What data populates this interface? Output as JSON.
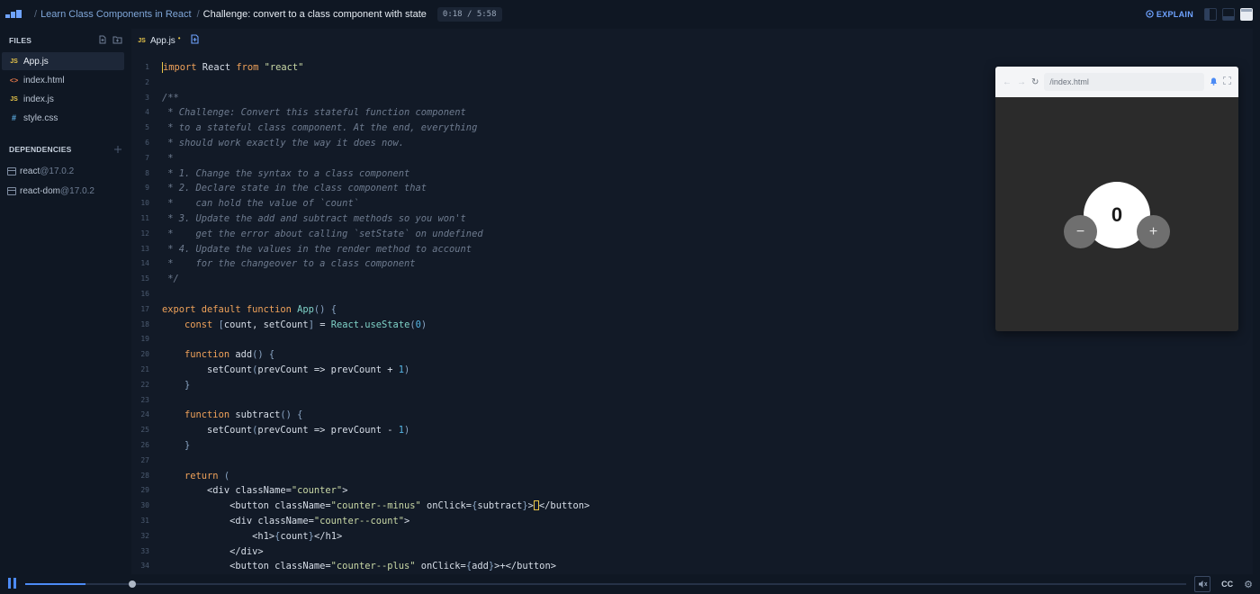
{
  "breadcrumb": {
    "course": "Learn Class Components in React",
    "lesson": "Challenge: convert to a class component with state",
    "timer": "0:18 / 5:58"
  },
  "header": {
    "explain_label": "EXPLAIN"
  },
  "sidebar": {
    "files_title": "FILES",
    "files": [
      {
        "name": "App.js",
        "type": "js",
        "type_label": "JS",
        "active": true
      },
      {
        "name": "index.html",
        "type": "html",
        "type_label": "<>",
        "active": false
      },
      {
        "name": "index.js",
        "type": "js",
        "type_label": "JS",
        "active": false
      },
      {
        "name": "style.css",
        "type": "css",
        "type_label": "#",
        "active": false
      }
    ],
    "deps_title": "DEPENDENCIES",
    "dependencies": [
      {
        "name": "react",
        "version": "@17.0.2"
      },
      {
        "name": "react-dom",
        "version": "@17.0.2"
      }
    ]
  },
  "editor": {
    "tab": {
      "label": "App.js",
      "icon_label": "JS",
      "modified": "•"
    },
    "lines": [
      [
        [
          "kw",
          "import"
        ],
        [
          "txt",
          " React "
        ],
        [
          "kw",
          "from"
        ],
        [
          "txt",
          " "
        ],
        [
          "str",
          "\"react\""
        ]
      ],
      [],
      [
        [
          "cmt",
          "/**"
        ]
      ],
      [
        [
          "cmt",
          " * Challenge: Convert this stateful function component"
        ]
      ],
      [
        [
          "cmt",
          " * to a stateful class component. At the end, everything"
        ]
      ],
      [
        [
          "cmt",
          " * should work exactly the way it does now."
        ]
      ],
      [
        [
          "cmt",
          " *"
        ]
      ],
      [
        [
          "cmt",
          " * 1. Change the syntax to a class component"
        ]
      ],
      [
        [
          "cmt",
          " * 2. Declare state in the class component that"
        ]
      ],
      [
        [
          "cmt",
          " *    can hold the value of `count`"
        ]
      ],
      [
        [
          "cmt",
          " * 3. Update the add and subtract methods so you won't"
        ]
      ],
      [
        [
          "cmt",
          " *    get the error about calling `setState` on undefined"
        ]
      ],
      [
        [
          "cmt",
          " * 4. Update the values in the render method to account"
        ]
      ],
      [
        [
          "cmt",
          " *    for the changeover to a class component"
        ]
      ],
      [
        [
          "cmt",
          " */"
        ]
      ],
      [],
      [
        [
          "kw",
          "export default function "
        ],
        [
          "fn",
          "App"
        ],
        [
          "br",
          "() {"
        ]
      ],
      [
        [
          "txt",
          "    "
        ],
        [
          "kw",
          "const "
        ],
        [
          "br",
          "["
        ],
        [
          "txt",
          "count, setCount"
        ],
        [
          "br",
          "]"
        ],
        [
          "txt",
          " = "
        ],
        [
          "fn",
          "React"
        ],
        [
          "txt",
          "."
        ],
        [
          "fn",
          "useState"
        ],
        [
          "br",
          "("
        ],
        [
          "num",
          "0"
        ],
        [
          "br",
          ")"
        ]
      ],
      [],
      [
        [
          "txt",
          "    "
        ],
        [
          "kw",
          "function "
        ],
        [
          "txt",
          "add"
        ],
        [
          "br",
          "() {"
        ]
      ],
      [
        [
          "txt",
          "        setCount"
        ],
        [
          "br",
          "("
        ],
        [
          "txt",
          "prevCount => prevCount + "
        ],
        [
          "num",
          "1"
        ],
        [
          "br",
          ")"
        ]
      ],
      [
        [
          "txt",
          "    "
        ],
        [
          "br",
          "}"
        ]
      ],
      [],
      [
        [
          "txt",
          "    "
        ],
        [
          "kw",
          "function "
        ],
        [
          "txt",
          "subtract"
        ],
        [
          "br",
          "() {"
        ]
      ],
      [
        [
          "txt",
          "        setCount"
        ],
        [
          "br",
          "("
        ],
        [
          "txt",
          "prevCount => prevCount - "
        ],
        [
          "num",
          "1"
        ],
        [
          "br",
          ")"
        ]
      ],
      [
        [
          "txt",
          "    "
        ],
        [
          "br",
          "}"
        ]
      ],
      [],
      [
        [
          "txt",
          "    "
        ],
        [
          "kw",
          "return "
        ],
        [
          "br",
          "("
        ]
      ],
      [
        [
          "txt",
          "        <div className="
        ],
        [
          "str",
          "\"counter\""
        ],
        [
          "txt",
          ">"
        ]
      ],
      [
        [
          "txt",
          "            <button className="
        ],
        [
          "str",
          "\"counter--minus\""
        ],
        [
          "txt",
          " onClick="
        ],
        [
          "br",
          "{"
        ],
        [
          "txt",
          "subtract"
        ],
        [
          "br",
          "}"
        ],
        [
          "txt",
          ">"
        ],
        [
          "cursorbox",
          ""
        ],
        [
          "txt",
          "</button>"
        ]
      ],
      [
        [
          "txt",
          "            <div className="
        ],
        [
          "str",
          "\"counter--count\""
        ],
        [
          "txt",
          ">"
        ]
      ],
      [
        [
          "txt",
          "                <h1>"
        ],
        [
          "br",
          "{"
        ],
        [
          "txt",
          "count"
        ],
        [
          "br",
          "}"
        ],
        [
          "txt",
          "</h1>"
        ]
      ],
      [
        [
          "txt",
          "            </div>"
        ]
      ],
      [
        [
          "txt",
          "            <button className="
        ],
        [
          "str",
          "\"counter--plus\""
        ],
        [
          "txt",
          " onClick="
        ],
        [
          "br",
          "{"
        ],
        [
          "txt",
          "add"
        ],
        [
          "br",
          "}"
        ],
        [
          "txt",
          ">+</button>"
        ]
      ]
    ]
  },
  "preview": {
    "url": "/index.html",
    "count": "0",
    "minus_label": "−",
    "plus_label": "+"
  },
  "player": {
    "progress": 0.052,
    "knob": 0.092,
    "cc_label": "CC"
  },
  "colors": {
    "accent": "#4c8bf5",
    "background": "#0f1723",
    "editor_bg": "#121a27"
  }
}
